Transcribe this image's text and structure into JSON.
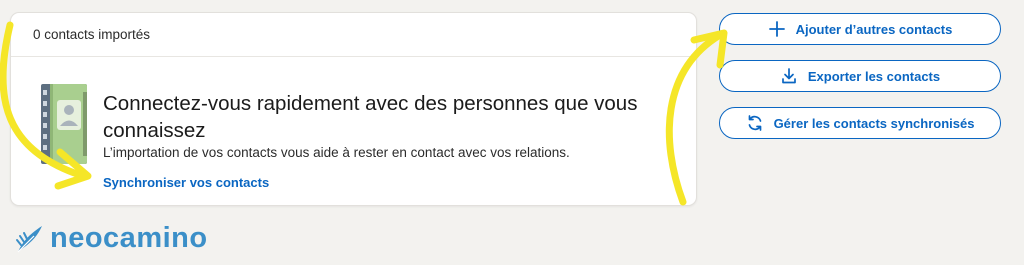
{
  "card": {
    "count_label": "0 contacts importés",
    "title": "Connectez-vous rapidement avec des personnes que vous connaissez",
    "subtitle": "L’importation de vos contacts vous aide à rester en contact avec vos relations.",
    "sync_link": "Synchroniser vos contacts"
  },
  "actions": {
    "add_label": "Ajouter d’autres contacts",
    "export_label": "Exporter les contacts",
    "manage_label": "Gérer les contacts synchronisés"
  },
  "icons": {
    "address_book": "address-book-icon",
    "add": "plus-icon",
    "export": "download-icon",
    "manage": "sync-icon",
    "logo": "feather-icon"
  },
  "logo": {
    "text": "neocamino"
  },
  "colors": {
    "accent": "#0a66c2",
    "annotation": "#f5e628",
    "logo": "#3b8fc8",
    "background": "#f3f2ef"
  }
}
